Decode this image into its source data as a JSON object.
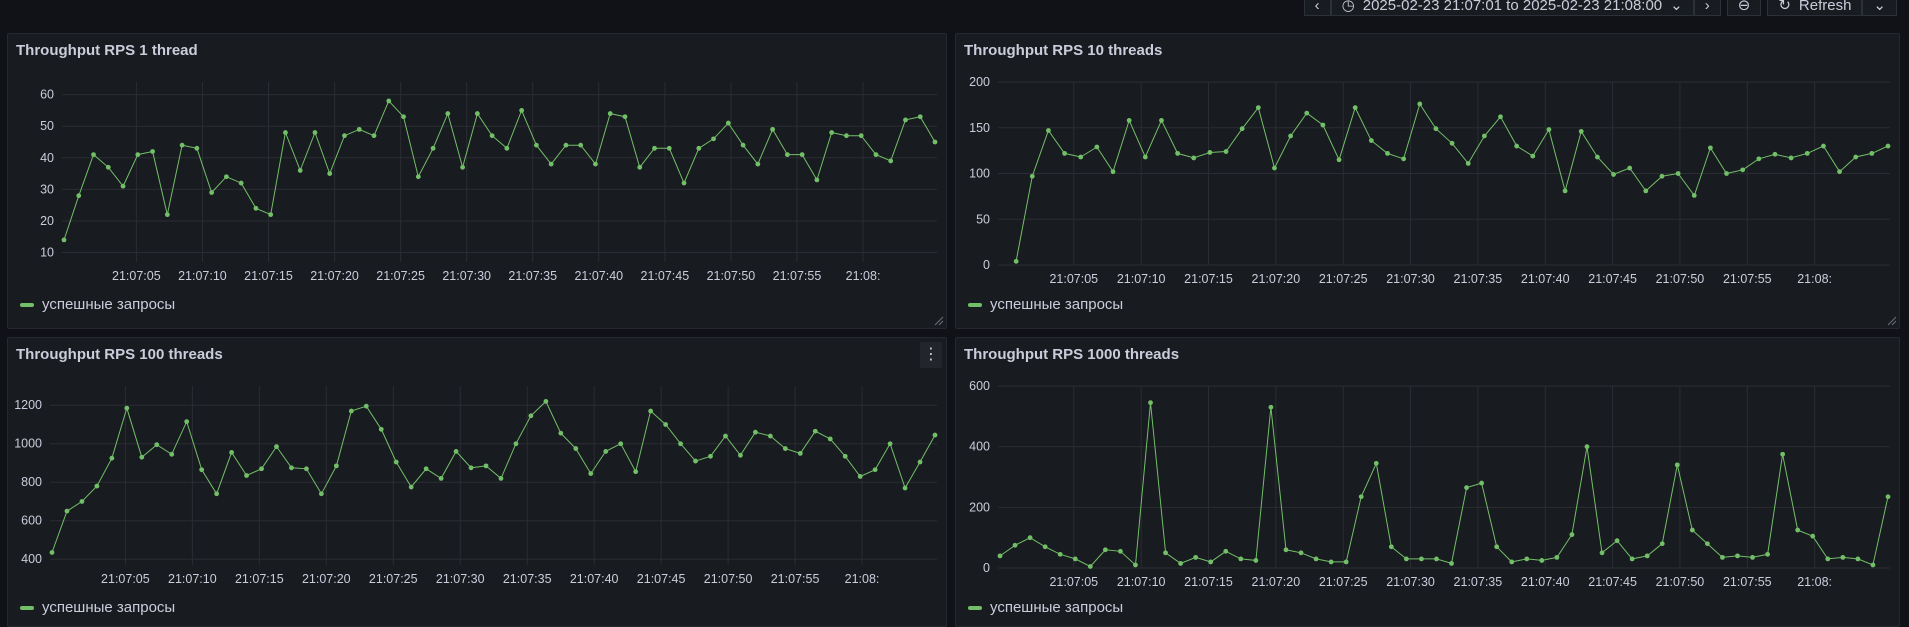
{
  "toolbar": {
    "time_range": "2025-02-23 21:07:01 to 2025-02-23 21:08:00",
    "refresh_label": "Refresh"
  },
  "panels": [
    {
      "title": "Throughput RPS 1 thread",
      "legend": "успешные запросы",
      "chart_data": {
        "type": "line",
        "title": "Throughput RPS 1 thread",
        "x_ticks": [
          "21:07:05",
          "21:07:10",
          "21:07:15",
          "21:07:20",
          "21:07:25",
          "21:07:30",
          "21:07:35",
          "21:07:40",
          "21:07:45",
          "21:07:50",
          "21:07:55",
          "21:08:"
        ],
        "y_ticks": [
          10,
          20,
          30,
          40,
          50,
          60
        ],
        "ylim": [
          7,
          64
        ],
        "series": [
          {
            "name": "успешные запросы",
            "values": [
              14,
              28,
              41,
              37,
              31,
              41,
              42,
              22,
              44,
              43,
              29,
              34,
              32,
              24,
              22,
              48,
              36,
              48,
              35,
              47,
              49,
              47,
              58,
              53,
              34,
              43,
              54,
              37,
              54,
              47,
              43,
              55,
              44,
              38,
              44,
              44,
              38,
              54,
              53,
              37,
              43,
              43,
              32,
              43,
              46,
              51,
              44,
              38,
              49,
              41,
              41,
              33,
              48,
              47,
              47,
              41,
              39,
              52,
              53,
              45
            ]
          }
        ]
      }
    },
    {
      "title": "Throughput RPS 10 threads",
      "legend": "успешные запросы",
      "chart_data": {
        "type": "line",
        "title": "Throughput RPS 10 threads",
        "x_ticks": [
          "21:07:05",
          "21:07:10",
          "21:07:15",
          "21:07:20",
          "21:07:25",
          "21:07:30",
          "21:07:35",
          "21:07:40",
          "21:07:45",
          "21:07:50",
          "21:07:55",
          "21:08:"
        ],
        "y_ticks": [
          0,
          50,
          100,
          150,
          200
        ],
        "ylim": [
          0,
          200
        ],
        "series": [
          {
            "name": "успешные запросы",
            "values": [
              null,
              4,
              97,
              147,
              122,
              118,
              129,
              102,
              158,
              118,
              158,
              122,
              117,
              123,
              124,
              149,
              172,
              106,
              141,
              166,
              153,
              115,
              172,
              136,
              122,
              116,
              176,
              149,
              133,
              111,
              141,
              162,
              130,
              119,
              148,
              81,
              146,
              118,
              99,
              106,
              81,
              97,
              100,
              76,
              128,
              100,
              104,
              116,
              121,
              117,
              122,
              130,
              102,
              118,
              122,
              130
            ]
          }
        ]
      }
    },
    {
      "title": "Throughput RPS 100 threads",
      "legend": "успешные запросы",
      "chart_data": {
        "type": "line",
        "title": "Throughput RPS 100 threads",
        "x_ticks": [
          "21:07:05",
          "21:07:10",
          "21:07:15",
          "21:07:20",
          "21:07:25",
          "21:07:30",
          "21:07:35",
          "21:07:40",
          "21:07:45",
          "21:07:50",
          "21:07:55",
          "21:08:"
        ],
        "y_ticks": [
          400,
          600,
          800,
          1000,
          1200
        ],
        "ylim": [
          370,
          1300
        ],
        "series": [
          {
            "name": "успешные запросы",
            "values": [
              435,
              650,
              700,
              780,
              925,
              1185,
              930,
              995,
              945,
              1115,
              865,
              740,
              955,
              835,
              870,
              985,
              875,
              870,
              740,
              885,
              1170,
              1195,
              1075,
              905,
              775,
              870,
              820,
              960,
              875,
              885,
              820,
              1000,
              1145,
              1220,
              1055,
              975,
              845,
              960,
              1000,
              855,
              1170,
              1100,
              1000,
              910,
              935,
              1040,
              940,
              1060,
              1040,
              975,
              950,
              1065,
              1025,
              935,
              830,
              865,
              1000,
              770,
              905,
              1045
            ]
          }
        ]
      }
    },
    {
      "title": "Throughput RPS 1000 threads",
      "legend": "успешные запросы",
      "chart_data": {
        "type": "line",
        "title": "Throughput RPS 1000 threads",
        "x_ticks": [
          "21:07:05",
          "21:07:10",
          "21:07:15",
          "21:07:20",
          "21:07:25",
          "21:07:30",
          "21:07:35",
          "21:07:40",
          "21:07:45",
          "21:07:50",
          "21:07:55",
          "21:08:"
        ],
        "y_ticks": [
          0,
          200,
          400,
          600
        ],
        "ylim": [
          0,
          600
        ],
        "series": [
          {
            "name": "успешные запросы",
            "values": [
              40,
              75,
              100,
              70,
              45,
              30,
              5,
              60,
              55,
              10,
              545,
              50,
              15,
              35,
              20,
              55,
              30,
              25,
              530,
              60,
              50,
              30,
              20,
              20,
              235,
              345,
              70,
              30,
              30,
              30,
              15,
              265,
              280,
              70,
              20,
              30,
              25,
              35,
              110,
              400,
              50,
              90,
              30,
              40,
              80,
              340,
              125,
              80,
              35,
              40,
              35,
              45,
              375,
              125,
              105,
              30,
              35,
              30,
              10,
              235
            ]
          }
        ]
      }
    }
  ]
}
